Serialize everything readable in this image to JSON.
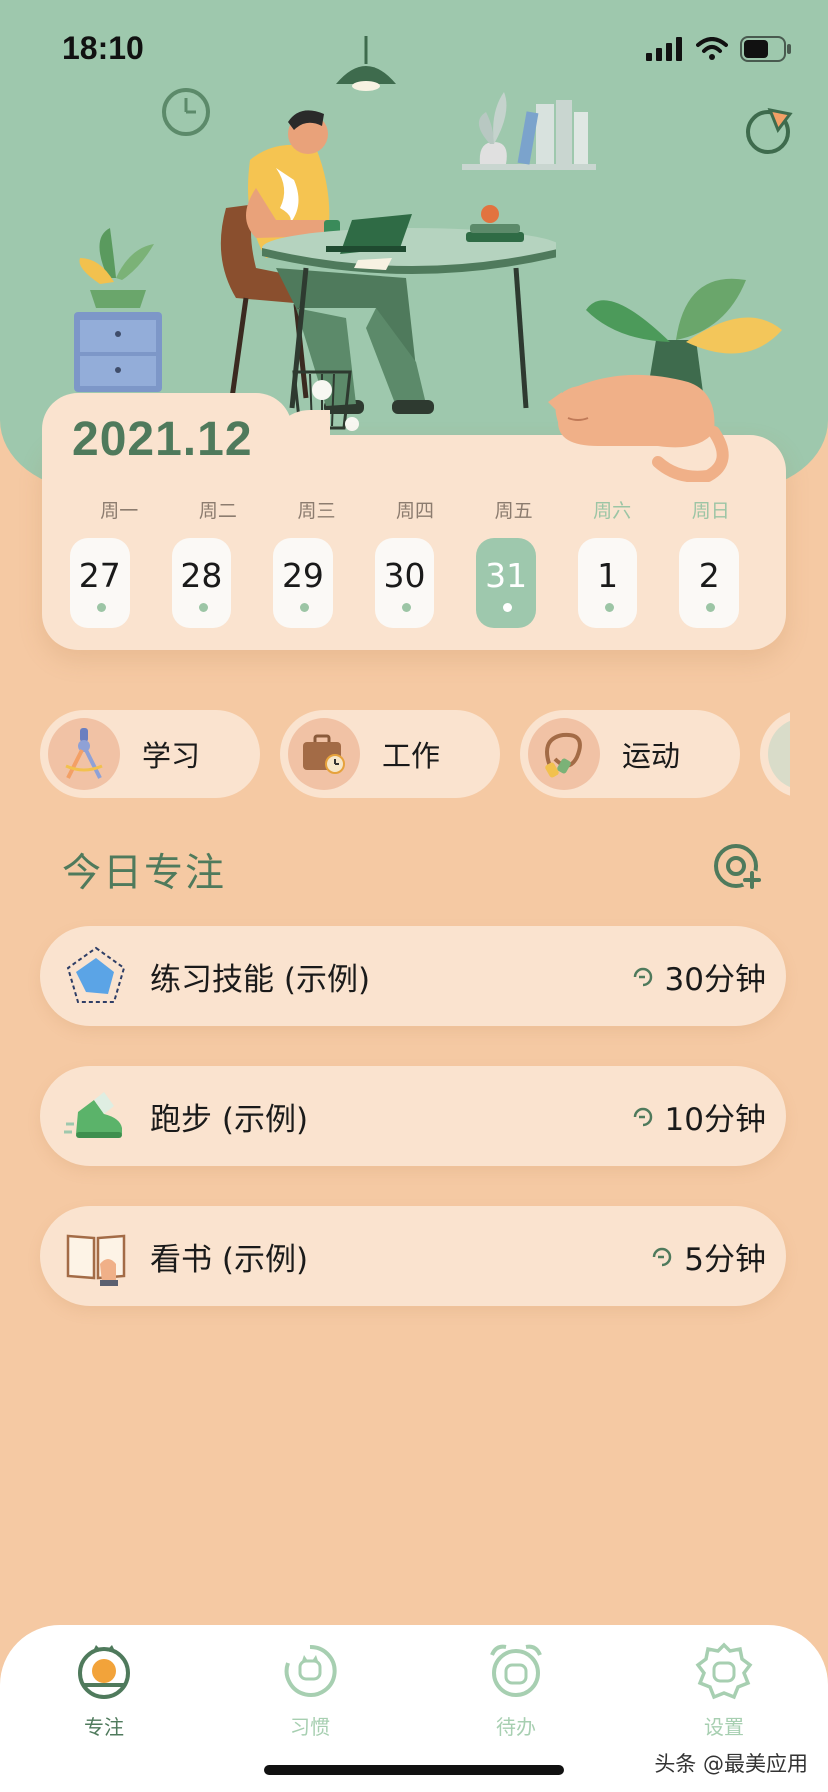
{
  "status_bar": {
    "time": "18:10"
  },
  "calendar": {
    "year_month": "2021.12",
    "weekdays": [
      "周一",
      "周二",
      "周三",
      "周四",
      "周五",
      "周六",
      "周日"
    ],
    "days": [
      "27",
      "28",
      "29",
      "30",
      "31",
      "1",
      "2"
    ],
    "selected_day": "31"
  },
  "categories": [
    {
      "label": "学习",
      "icon": "compass-drawing-icon"
    },
    {
      "label": "工作",
      "icon": "briefcase-clock-icon"
    },
    {
      "label": "运动",
      "icon": "jump-rope-icon"
    }
  ],
  "focus": {
    "title": "今日专注",
    "tasks": [
      {
        "name": "练习技能 (示例)",
        "duration": "30分钟",
        "icon": "pentagon-skill-icon"
      },
      {
        "name": "跑步 (示例)",
        "duration": "10分钟",
        "icon": "running-shoe-icon"
      },
      {
        "name": "看书 (示例)",
        "duration": "5分钟",
        "icon": "open-book-icon"
      }
    ]
  },
  "tabbar": {
    "tabs": [
      {
        "label": "专注",
        "icon": "focus-cat-icon"
      },
      {
        "label": "习惯",
        "icon": "habit-cat-icon"
      },
      {
        "label": "待办",
        "icon": "alarm-cat-icon"
      },
      {
        "label": "设置",
        "icon": "gear-cat-icon"
      }
    ],
    "active": "专注"
  },
  "watermark": "头条 @最美应用",
  "colors": {
    "hero_green": "#9ec8ad",
    "accent_green": "#4f7a5c",
    "background_peach": "#f5c9a3",
    "card_cream": "#fae3cf"
  }
}
